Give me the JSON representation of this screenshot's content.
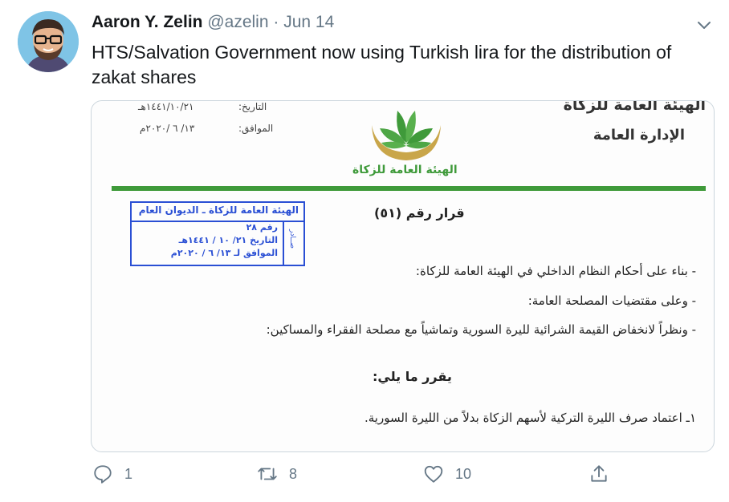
{
  "tweet": {
    "author_name": "Aaron Y. Zelin",
    "handle": "@azelin",
    "separator": "·",
    "date": "Jun 14",
    "text": "HTS/Salvation Government now using Turkish lira for the distribution of zakat shares"
  },
  "document": {
    "date_label": "التاريخ:",
    "date_value": "١٤٤١/١٠/٢١هـ",
    "corresponding_label": "الموافق:",
    "corresponding_value": "١٣/ ٦ /٢٠٢٠م",
    "org_header": "الهيئة العامة للزكاة",
    "org_dept": "الإدارة العامة",
    "logo_caption": "الهيئة العامة للزكاة",
    "stamp_title": "الهيئة العامة للزكاة ـ الديوان العام",
    "stamp_side": "صــادر",
    "stamp_number_line": "رقم       ٢٨",
    "stamp_date_line": "التاريخ  ٢١/ ١٠ / ١٤٤١هـ",
    "stamp_corresponding_line": "الموافق لـ ١٣/ ٦ / ٢٠٢٠م",
    "decision_title": "قرار رقم (٥١)",
    "clause_1": "-   بناء على أحكام النظام الداخلي في الهيئة العامة للزكاة:",
    "clause_2": "-   وعلى مقتضيات المصلحة العامة:",
    "clause_3": "-   ونظراً لانخفاض القيمة الشرائية لليرة السورية وتماشياً مع مصلحة الفقراء والمساكين:",
    "decides": "يقرر ما يلي:",
    "article_1": "١ـ اعتماد صرف الليرة التركية لأسهم الزكاة بدلاً من الليرة السورية."
  },
  "actions": {
    "reply_count": "1",
    "retweet_count": "8",
    "like_count": "10"
  },
  "colors": {
    "accent_green": "#3f9a3a",
    "stamp_blue": "#2a4fd4",
    "logo_gold": "#c9a64a",
    "muted": "#657786"
  },
  "icons": [
    "avatar",
    "chevron-down-icon",
    "reply-icon",
    "retweet-icon",
    "like-icon",
    "share-icon",
    "leaf-logo-icon"
  ]
}
